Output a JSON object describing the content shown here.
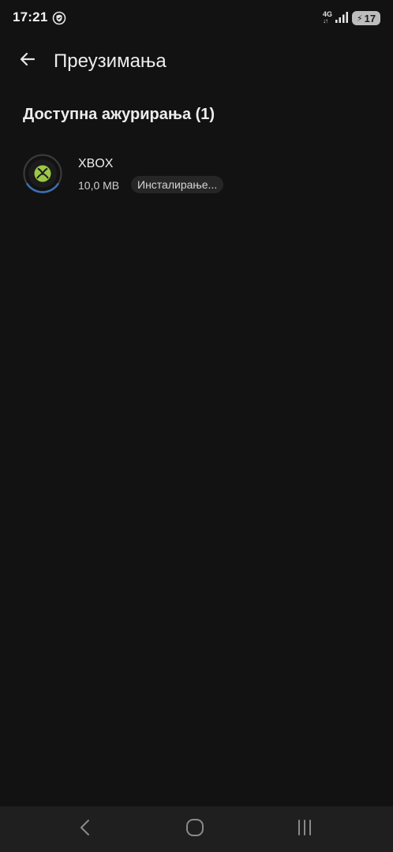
{
  "status_bar": {
    "time": "17:21",
    "network": "4G",
    "network_arrows": "↓↑",
    "battery": "17"
  },
  "app_bar": {
    "title": "Преузимања"
  },
  "section": {
    "title": "Доступна ажурирања (1)"
  },
  "updates": [
    {
      "name": "XBOX",
      "size": "10,0 MB",
      "status": "Инсталирање..."
    }
  ],
  "colors": {
    "background": "#121212",
    "xbox_green": "#9bc848",
    "progress_blue": "#3d6fb3",
    "nav_bar": "#1f1f1f"
  },
  "icons": {
    "back": "arrow-left-icon",
    "status": "shield-icon",
    "signal": "signal-icon",
    "battery": "battery-charging-icon",
    "nav_back": "chevron-left-icon",
    "nav_home": "home-rounded-square-icon",
    "nav_recents": "recents-icon"
  }
}
